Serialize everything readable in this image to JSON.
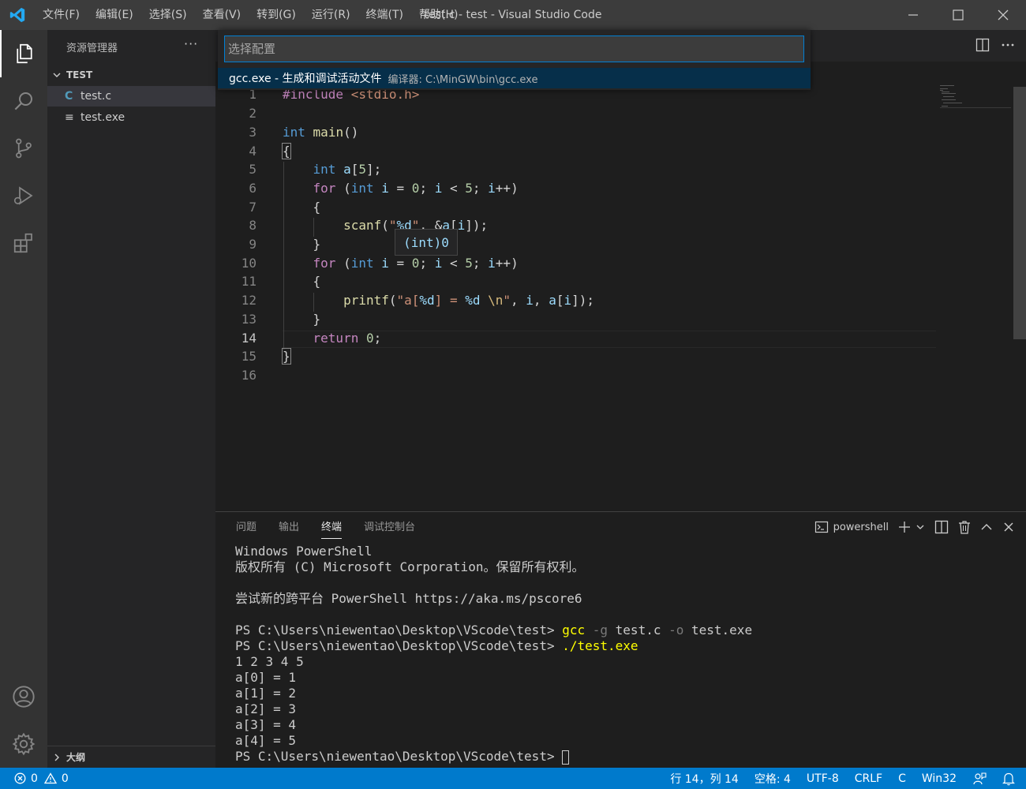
{
  "titlebar": {
    "menu": [
      "文件(F)",
      "编辑(E)",
      "选择(S)",
      "查看(V)",
      "转到(G)",
      "运行(R)",
      "终端(T)",
      "帮助(H)"
    ],
    "title": "test.c - test - Visual Studio Code"
  },
  "sidebar": {
    "title": "资源管理器",
    "more": "···",
    "folder": "TEST",
    "files": [
      {
        "name": "test.c",
        "icon": "C"
      },
      {
        "name": "test.exe",
        "icon": "≡"
      }
    ],
    "outline": "大纲"
  },
  "quickpick": {
    "placeholder": "选择配置",
    "item_label": "gcc.exe - 生成和调试活动文件",
    "item_desc": "编译器: C:\\MinGW\\bin\\gcc.exe"
  },
  "editor": {
    "line_numbers": [
      "1",
      "2",
      "3",
      "4",
      "5",
      "6",
      "7",
      "8",
      "9",
      "10",
      "11",
      "12",
      "13",
      "14",
      "15",
      "16"
    ],
    "current_line": "14",
    "hover": "(int)0"
  },
  "panel": {
    "tabs": [
      "问题",
      "输出",
      "终端",
      "调试控制台"
    ],
    "active_tab": "终端",
    "shell": "powershell",
    "terminal": {
      "l1": "Windows PowerShell",
      "l2": "版权所有 (C) Microsoft Corporation。保留所有权利。",
      "l3": "尝试新的跨平台 PowerShell https://aka.ms/pscore6",
      "prompt": "PS C:\\Users\\niewentao\\Desktop\\VScode\\test> ",
      "cmd1_a": "gcc",
      "cmd1_b": " -g",
      "cmd1_c": " test.c",
      "cmd1_d": " -o",
      "cmd1_e": " test.exe",
      "cmd2": "./test.exe",
      "out": [
        "1 2 3 4 5",
        "a[0] = 1",
        "a[1] = 2",
        "a[2] = 3",
        "a[3] = 4",
        "a[4] = 5"
      ]
    }
  },
  "statusbar": {
    "errors": "0",
    "warnings": "0",
    "position": "行 14，列 14",
    "spaces": "空格: 4",
    "encoding": "UTF-8",
    "eol": "CRLF",
    "language": "C",
    "platform": "Win32"
  },
  "colors": {
    "accent": "#007acc",
    "quickpick_selected": "#062f4a"
  }
}
